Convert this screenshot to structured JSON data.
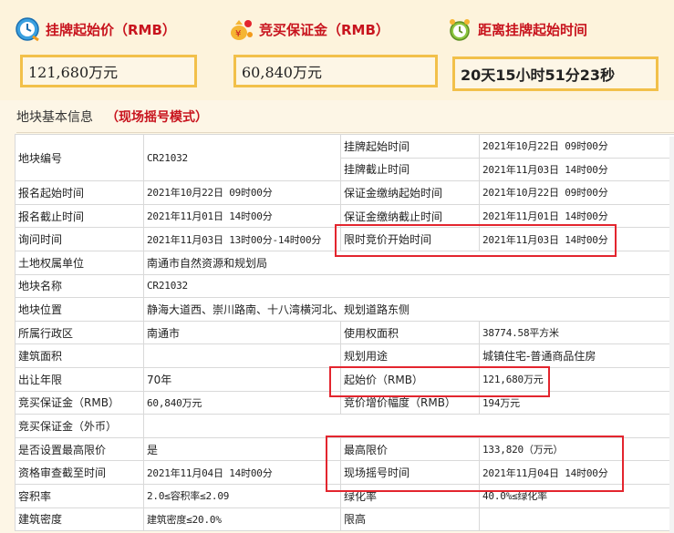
{
  "cards": [
    {
      "title": "挂牌起始价（RMB）",
      "value": "121,680万元",
      "icon": "clock-icon"
    },
    {
      "title": "竞买保证金（RMB）",
      "value": "60,840万元",
      "icon": "money-bag-icon"
    },
    {
      "title": "距离挂牌起始时间",
      "value": "20天15小时51分23秒",
      "icon": "alarm-clock-icon"
    }
  ],
  "section": {
    "title": "地块基本信息",
    "mode": "（现场摇号模式）"
  },
  "table": {
    "r1": {
      "k1": "地块编号",
      "v1": "CR21032",
      "k2": "挂牌起始时间",
      "v2": "2021年10月22日 09时00分"
    },
    "r2": {
      "k2": "挂牌截止时间",
      "v2": "2021年11月03日 14时00分"
    },
    "r3": {
      "k1": "报名起始时间",
      "v1": "2021年10月22日 09时00分",
      "k2": "保证金缴纳起始时间",
      "v2": "2021年10月22日 09时00分"
    },
    "r4": {
      "k1": "报名截止时间",
      "v1": "2021年11月01日 14时00分",
      "k2": "保证金缴纳截止时间",
      "v2": "2021年11月01日 14时00分"
    },
    "r5": {
      "k1": "询问时间",
      "v1": "2021年11月03日 13时00分-14时00分",
      "k2": "限时竞价开始时间",
      "v2": "2021年11月03日 14时00分"
    },
    "r6": {
      "k1": "土地权属单位",
      "v1": "南通市自然资源和规划局"
    },
    "r7": {
      "k1": "地块名称",
      "v1": "CR21032"
    },
    "r8": {
      "k1": "地块位置",
      "v1": "静海大道西、崇川路南、十八湾横河北、规划道路东侧"
    },
    "r9": {
      "k1": "所属行政区",
      "v1": "南通市",
      "k2": "使用权面积",
      "v2": "38774.58平方米"
    },
    "r10": {
      "k1": "建筑面积",
      "v1": "",
      "k2": "规划用途",
      "v2": "城镇住宅-普通商品住房"
    },
    "r11": {
      "k1": "出让年限",
      "v1": "70年",
      "k2": "起始价（RMB）",
      "v2": "121,680万元"
    },
    "r12": {
      "k1": "竞买保证金（RMB）",
      "v1": "60,840万元",
      "k2": "竞价增价幅度（RMB）",
      "v2": "194万元"
    },
    "r13": {
      "k1": "竞买保证金（外币）",
      "v1": ""
    },
    "r14": {
      "k1": "是否设置最高限价",
      "v1": "是",
      "k2": "最高限价",
      "v2": "133,820（万元）"
    },
    "r15": {
      "k1": "资格审查截至时间",
      "v1": "2021年11月04日 14时00分",
      "k2": "现场摇号时间",
      "v2": "2021年11月04日 14时00分"
    },
    "r16": {
      "k1": "容积率",
      "v1": "2.0≤容积率≤2.09",
      "k2": "绿化率",
      "v2": "40.0%≤绿化率"
    },
    "r17": {
      "k1": "建筑密度",
      "v1": "建筑密度≤20.0%",
      "k2": "限高",
      "v2": ""
    }
  },
  "colors": {
    "accent": "#c8141e",
    "card_border": "#f2c04a",
    "highlight": "#e3252e",
    "background": "#fdf6e6"
  }
}
